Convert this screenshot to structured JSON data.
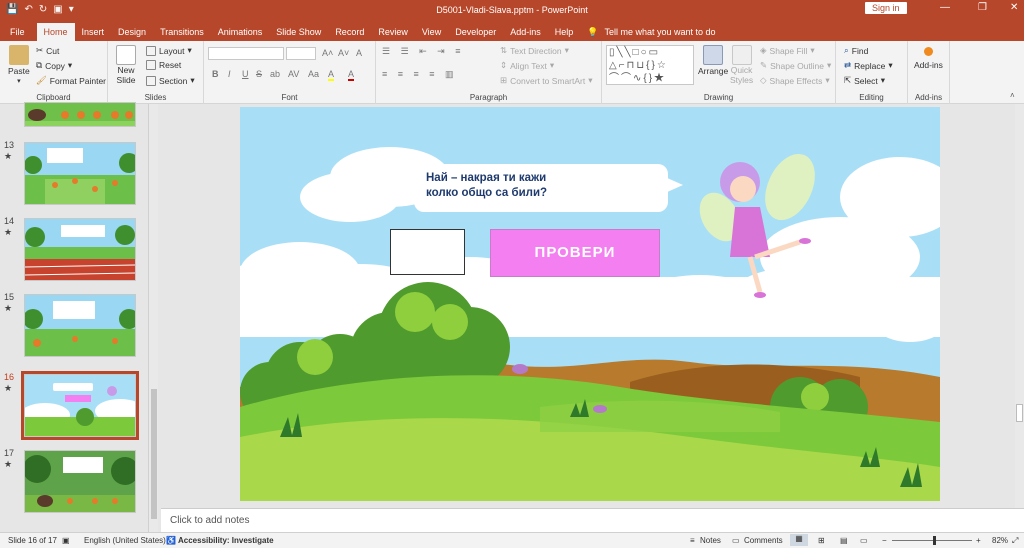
{
  "window": {
    "title": "D5001-Vladi-Slava.pptm  -  PowerPoint",
    "signin": "Sign in",
    "minimize": "—",
    "restore": "❐",
    "close": "✕"
  },
  "tabs": [
    "File",
    "Home",
    "Insert",
    "Design",
    "Transitions",
    "Animations",
    "Slide Show",
    "Record",
    "Review",
    "View",
    "Developer",
    "Add-ins",
    "Help"
  ],
  "tell_me": "Tell me what you want to do",
  "ribbon": {
    "clipboard": {
      "label": "Clipboard",
      "paste": "Paste",
      "cut": "Cut",
      "copy": "Copy",
      "format_painter": "Format Painter"
    },
    "slides": {
      "label": "Slides",
      "new_slide": "New",
      "new_slide2": "Slide",
      "layout": "Layout",
      "reset": "Reset",
      "section": "Section"
    },
    "font": {
      "label": "Font",
      "bold": "B",
      "italic": "I",
      "underline": "U",
      "strike": "S",
      "shadow": "ab",
      "spacing": "AV",
      "case": "Aa",
      "color": "A",
      "highlight": "A"
    },
    "paragraph": {
      "label": "Paragraph",
      "text_direction": "Text Direction",
      "align_text": "Align Text",
      "smartart": "Convert to SmartArt"
    },
    "drawing": {
      "label": "Drawing",
      "arrange": "Arrange",
      "quick_styles": "Quick",
      "quick_styles2": "Styles",
      "shape_fill": "Shape Fill",
      "shape_outline": "Shape Outline",
      "shape_effects": "Shape Effects"
    },
    "editing": {
      "label": "Editing",
      "find": "Find",
      "replace": "Replace",
      "select": "Select"
    },
    "addins": {
      "label": "Add-ins",
      "addins": "Add-ins"
    }
  },
  "thumbnails": [
    {
      "num": "13",
      "star": "★"
    },
    {
      "num": "14",
      "star": "★"
    },
    {
      "num": "15",
      "star": "★"
    },
    {
      "num": "16",
      "star": "★"
    },
    {
      "num": "17",
      "star": "★"
    }
  ],
  "slide": {
    "question_line1": "Най – накрая ти кажи",
    "question_line2": "колко общо са били?",
    "check_button": "ПРОВЕРИ"
  },
  "notes_placeholder": "Click to add notes",
  "status": {
    "slide": "Slide 16 of 17",
    "language": "English (United States)",
    "accessibility": "Accessibility: Investigate",
    "notes": "Notes",
    "comments": "Comments",
    "zoom": "82%"
  },
  "colors": {
    "accent": "#b7472a",
    "button": "#f47ff0",
    "question": "#1f3a6e"
  }
}
